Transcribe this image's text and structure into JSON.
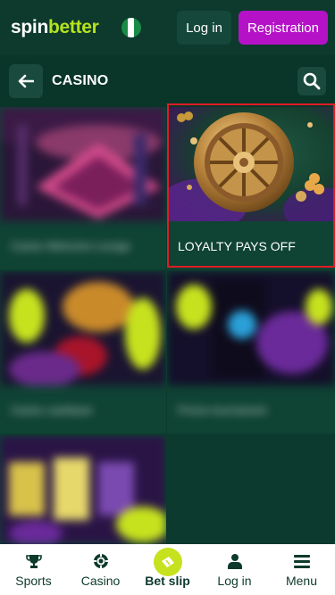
{
  "header": {
    "logo_part1": "spin",
    "logo_part2": "better",
    "flag_icon": "nigeria-flag-icon",
    "login_label": "Log in",
    "registration_label": "Registration"
  },
  "subheader": {
    "back_icon": "arrow-left-icon",
    "title": "CASINO",
    "search_icon": "search-icon"
  },
  "cards": [
    {
      "caption": "Casino Welcome Lounge",
      "blurred": true
    },
    {
      "caption": "LOYALTY PAYS OFF",
      "blurred": false
    },
    {
      "caption": "Casino cashback",
      "blurred": true
    },
    {
      "caption": "Promo tournament",
      "blurred": true
    },
    {
      "caption": "",
      "blurred": true
    }
  ],
  "bottom_nav": {
    "items": [
      {
        "label": "Sports",
        "icon": "trophy-icon"
      },
      {
        "label": "Casino",
        "icon": "casino-chip-icon"
      },
      {
        "label": "Bet slip",
        "icon": "ticket-icon"
      },
      {
        "label": "Log in",
        "icon": "user-icon"
      },
      {
        "label": "Menu",
        "icon": "menu-icon"
      }
    ]
  },
  "colors": {
    "background": "#0b3a2e",
    "brand_green": "#b6e31e",
    "registration_purple": "#b512c8",
    "highlight_red": "#e01c24"
  }
}
